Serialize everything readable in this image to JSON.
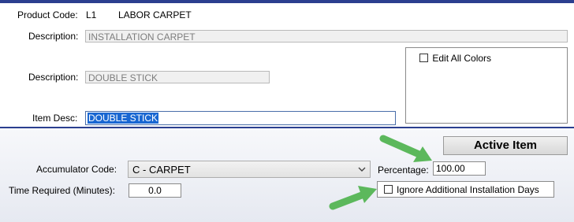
{
  "header": {
    "product_code_label": "Product Code:",
    "product_code_value": "L1",
    "product_name": "LABOR CARPET"
  },
  "fields": {
    "description1_label": "Description:",
    "description1_value": "INSTALLATION CARPET",
    "description2_label": "Description:",
    "description2_value": "DOUBLE STICK",
    "item_desc_label": "Item Desc:",
    "item_desc_value": "DOUBLE STICK"
  },
  "colors_panel": {
    "edit_all_colors_label": "Edit All Colors",
    "edit_all_colors_checked": false
  },
  "lower": {
    "active_item_button": "Active Item",
    "accumulator_label": "Accumulator Code:",
    "accumulator_value": "C - CARPET",
    "percentage_label": "Percentage:",
    "percentage_value": "100.00",
    "time_required_label": "Time Required (Minutes):",
    "time_required_value": "0.0",
    "ignore_days_label": "Ignore Additional Installation Days",
    "ignore_days_checked": false
  },
  "annotations": {
    "arrow_color": "#5cb85c",
    "arrow_icon": "green-arrow-icon"
  },
  "colors": {
    "divider": "#2b3f8f",
    "selection": "#1967d2"
  }
}
